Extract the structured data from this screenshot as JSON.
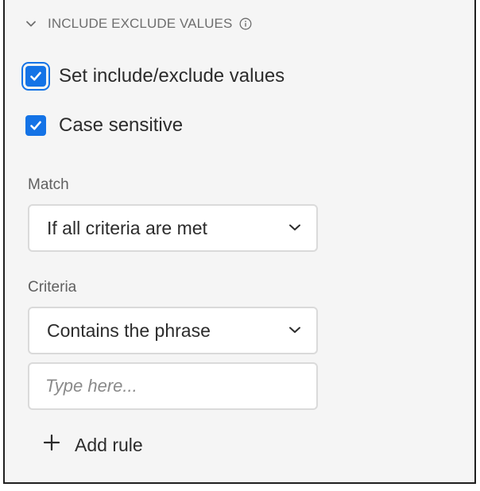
{
  "section": {
    "title": "INCLUDE EXCLUDE VALUES",
    "collapse_icon": "chevron-down-icon",
    "info_icon": "info-icon"
  },
  "checkboxes": {
    "set_include_exclude": {
      "label": "Set include/exclude values",
      "checked": true
    },
    "case_sensitive": {
      "label": "Case sensitive",
      "checked": true
    }
  },
  "match": {
    "label": "Match",
    "selected": "If all criteria are met"
  },
  "criteria": {
    "label": "Criteria",
    "selected": "Contains the phrase",
    "input_placeholder": "Type here...",
    "input_value": ""
  },
  "add_rule": {
    "label": "Add rule",
    "icon": "plus-icon"
  },
  "colors": {
    "accent": "#1473e6",
    "panel_bg": "#f5f5f5",
    "text": "#2c2c2c",
    "muted": "#6e6e6e"
  }
}
